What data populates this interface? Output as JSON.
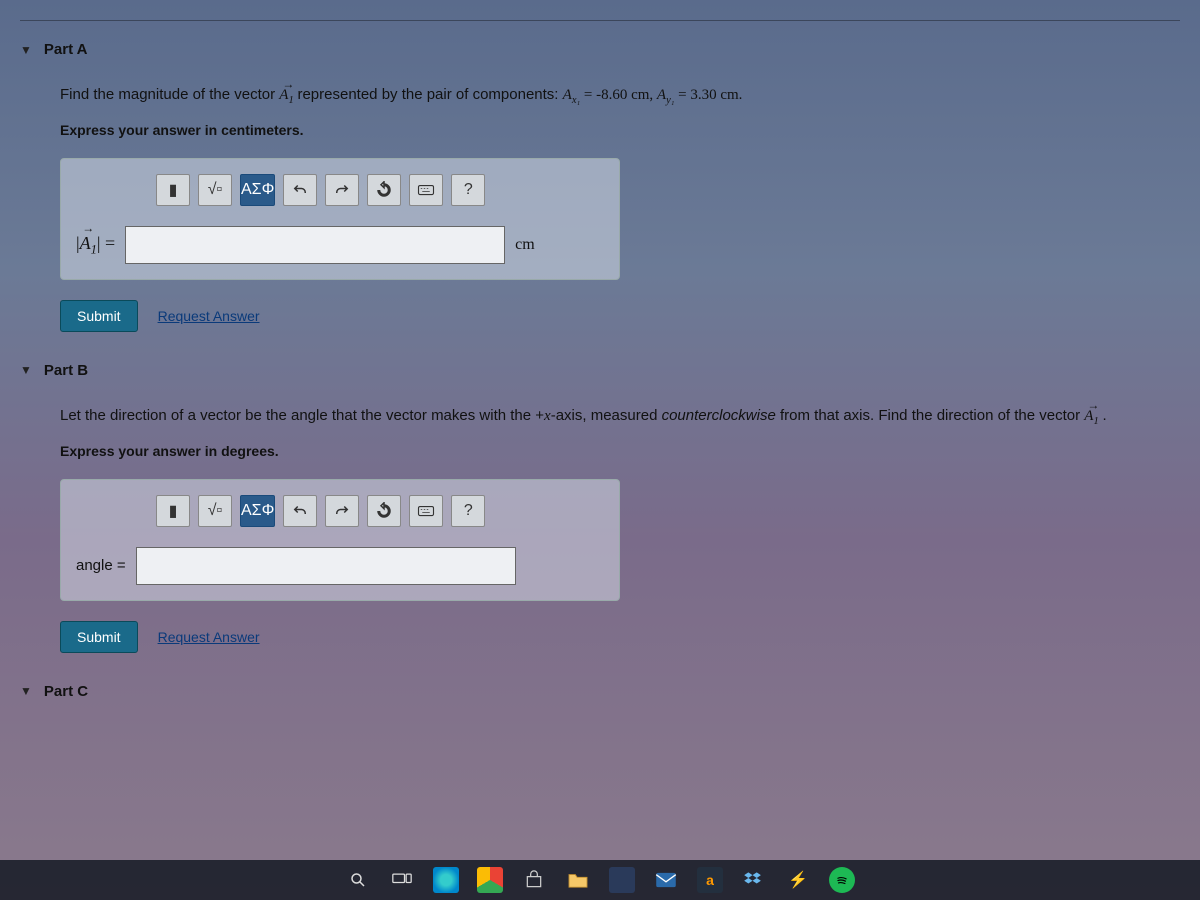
{
  "partA": {
    "title": "Part A",
    "prompt_pre": "Find the magnitude of the vector ",
    "vector_label": "A",
    "vector_sub": "1",
    "prompt_mid": " represented by the pair of components: ",
    "comp_ax_label": "A",
    "comp_ax_sub": "x₁",
    "comp_ax_val": " = -8.60 cm, ",
    "comp_ay_label": "A",
    "comp_ay_sub": "y₁",
    "comp_ay_val": " = 3.30 cm.",
    "instruct": "Express your answer in centimeters.",
    "lhs_open": "|",
    "lhs_vec": "A",
    "lhs_sub": "1",
    "lhs_close": "| =",
    "unit": "cm",
    "submit": "Submit",
    "request": "Request Answer",
    "toolbar": {
      "templates": "▮",
      "fraction": "√▫",
      "greek": "ΑΣΦ",
      "help": "?"
    }
  },
  "partB": {
    "title": "Part B",
    "text1": "Let the direction of a vector be the angle that the vector makes with the +",
    "x_var": "x",
    "text2": "-axis, measured ",
    "ccw": "counterclockwise",
    "text3": " from that axis. Find the direction of the vector ",
    "vector_label": "A",
    "vector_sub": "1",
    "instruct": "Express your answer in degrees.",
    "lhs": "angle =",
    "submit": "Submit",
    "request": "Request Answer",
    "toolbar": {
      "templates": "▮",
      "fraction": "√▫",
      "greek": "ΑΣΦ",
      "help": "?"
    }
  },
  "partC": {
    "title": "Part C"
  }
}
